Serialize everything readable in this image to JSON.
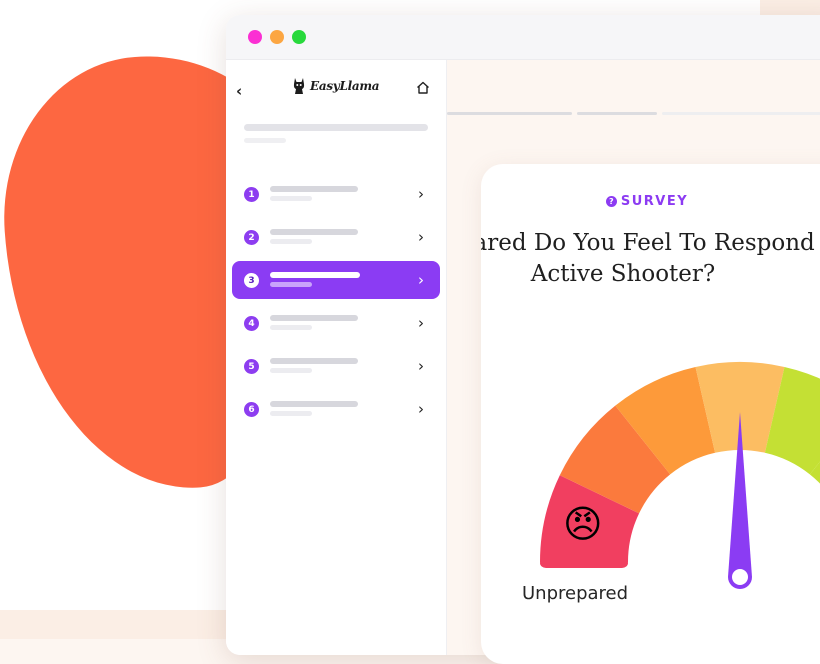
{
  "brand": {
    "name": "EasyLlama"
  },
  "sidebar": {
    "modules": [
      {
        "number": "1"
      },
      {
        "number": "2"
      },
      {
        "number": "3",
        "active": true
      },
      {
        "number": "4"
      },
      {
        "number": "5"
      },
      {
        "number": "6"
      }
    ]
  },
  "survey": {
    "tag": "SURVEY",
    "question": "How Prepared Do You Feel To Respond To An Active Shooter?",
    "scale_low_label": "Unprepared",
    "gauge_emoji": "😠",
    "gauge_level": 0.5
  },
  "colors": {
    "accent": "#8b3cf3",
    "blob": "#fd6741",
    "gauge_segments": [
      "#f13f60",
      "#fb7a3d",
      "#fd9a3a",
      "#fcbd62",
      "#c4e034"
    ]
  }
}
